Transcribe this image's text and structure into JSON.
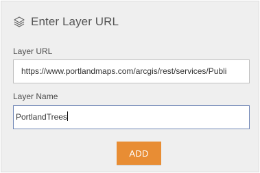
{
  "dialog": {
    "title": "Enter Layer URL",
    "icon": "layers-icon"
  },
  "form": {
    "url_label": "Layer URL",
    "url_value": "https://www.portlandmaps.com/arcgis/rest/services/Publi",
    "name_label": "Layer Name",
    "name_value": "PortlandTrees",
    "add_label": "ADD"
  },
  "colors": {
    "panel_bg": "#efefef",
    "accent_button": "#e88d34",
    "focus_border": "#6f86b6"
  }
}
